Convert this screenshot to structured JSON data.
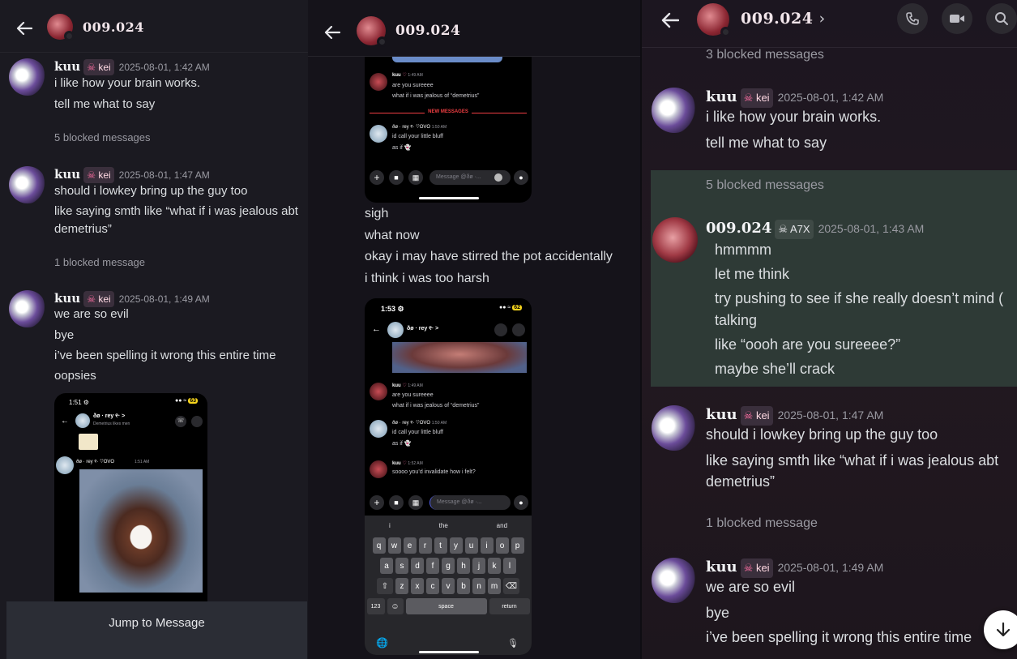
{
  "panel1": {
    "title": "009.024",
    "messages": [
      {
        "user": "kuu",
        "tag": "kei",
        "time": "2025-08-01, 1:42 AM",
        "lines": [
          "i like how your brain works.",
          "tell me what to say"
        ]
      },
      {
        "user": "kuu",
        "tag": "kei",
        "time": "2025-08-01, 1:47 AM",
        "lines": [
          "should i lowkey bring up the guy too",
          "like saying smth like “what if i was jealous abt",
          "demetrius”"
        ]
      },
      {
        "user": "kuu",
        "tag": "kei",
        "time": "2025-08-01, 1:49 AM",
        "lines": [
          "we are so evil",
          "bye",
          "i’ve been spelling it wrong this entire time",
          "oopsies"
        ]
      }
    ],
    "blocked": [
      "5 blocked messages",
      "1 blocked message"
    ],
    "phone": {
      "time": "1:51",
      "battery": "63",
      "contact": "ðø · rey ୧· >",
      "status": "Demetrius likes men",
      "msg_user": "ðø · rey ୧· ♡OVO",
      "msg_time": "1:51 AM"
    },
    "jump": "Jump to Message"
  },
  "panel2": {
    "title": "009.024",
    "phone_top": {
      "kuu_line1": "are you sureeee",
      "kuu_line2": "what if i was jealous of “demetrius”",
      "kuu_user": "kuu",
      "kuu_time": "1:49 AM",
      "new_messages": "NEW MESSAGES",
      "rey_user": "ðø · rey ୧· ♡OVO",
      "rey_time": "1:50 AM",
      "rey_line1": "id call your little bluff",
      "rey_line2": "as if",
      "placeholder": "Message @ðø ·..."
    },
    "lines": [
      "sigh",
      "what now",
      "okay i may have stirred the pot accidentally",
      "i think i was too harsh"
    ],
    "phone2": {
      "time": "1:53",
      "battery": "62",
      "contact": "ðø · rey ୧· >",
      "kuu_user": "kuu",
      "kuu_time": "1:49 AM",
      "kuu_line1": "are you sureeee",
      "kuu_line2": "what if i was jealous of “demetrius”",
      "rey_user": "ðø · rey ୧· ♡OVO",
      "rey_time": "1:50 AM",
      "rey_line1": "id call your little bluff",
      "rey_line2": "as if",
      "kuu2_time": "1:52 AM",
      "kuu2_line": "soooo you’d invalidate how i felt?",
      "placeholder": "Message @ðø ·...",
      "suggestions": [
        "i",
        "the",
        "and"
      ],
      "row1": [
        "q",
        "w",
        "e",
        "r",
        "t",
        "y",
        "u",
        "i",
        "o",
        "p"
      ],
      "row2": [
        "a",
        "s",
        "d",
        "f",
        "g",
        "h",
        "j",
        "k",
        "l"
      ],
      "row3": [
        "z",
        "x",
        "c",
        "v",
        "b",
        "n",
        "m"
      ],
      "num": "123",
      "space": "space",
      "ret": "return"
    }
  },
  "panel3": {
    "title": "009.024",
    "blocked_top": "3 blocked messages",
    "msg1": {
      "user": "kuu",
      "tag": "kei",
      "time": "2025-08-01, 1:42 AM",
      "lines": [
        "i like how your brain works.",
        "tell me what to say"
      ]
    },
    "blocked5": "5 blocked messages",
    "msg2": {
      "user": "009.024",
      "tag": "A7X",
      "time": "2025-08-01, 1:43 AM",
      "lines": [
        "hmmmm",
        "let me think",
        "try pushing to see if she really doesn’t mind (",
        "talking",
        "like “oooh are you sureeee?”",
        "maybe she’ll crack"
      ]
    },
    "msg3": {
      "user": "kuu",
      "tag": "kei",
      "time": "2025-08-01, 1:47 AM",
      "lines": [
        "should i lowkey bring up the guy too",
        "like saying smth like “what if i was jealous abt",
        "demetrius”"
      ]
    },
    "blocked1": "1 blocked message",
    "msg4": {
      "user": "kuu",
      "tag": "kei",
      "time": "2025-08-01, 1:49 AM",
      "lines": [
        "we are so evil",
        "bye",
        "i’ve been spelling it wrong this entire time"
      ]
    }
  },
  "icons": [
    "arrow-left-icon",
    "phone-call-icon",
    "video-camera-icon",
    "search-icon",
    "arrow-down-icon"
  ],
  "colors": {
    "accent_pink": "#ff6fa3",
    "highlight": "#2e3a36",
    "new_messages": "#f23f43"
  }
}
